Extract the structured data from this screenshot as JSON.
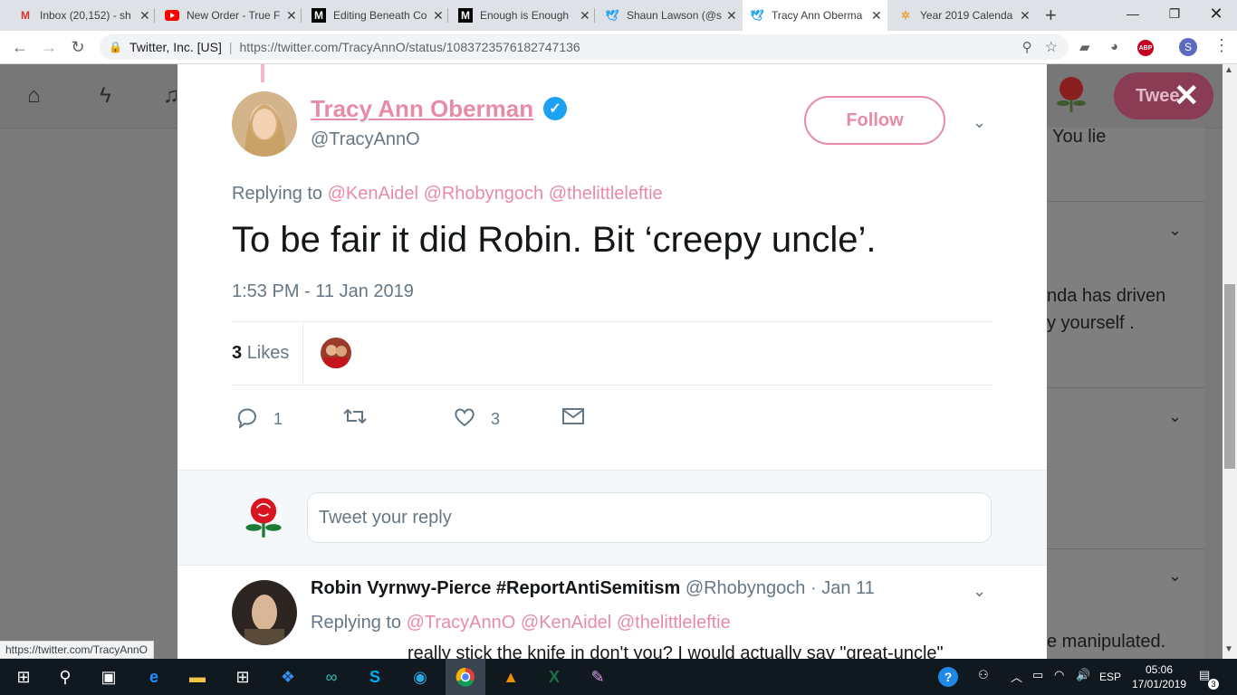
{
  "browser": {
    "tabs": [
      {
        "title": "Inbox (20,152) - sh",
        "icon": "gmail-icon"
      },
      {
        "title": "New Order - True F",
        "icon": "youtube-icon"
      },
      {
        "title": "Editing Beneath Co",
        "icon": "medium-icon"
      },
      {
        "title": "Enough is Enough",
        "icon": "medium-icon"
      },
      {
        "title": "Shaun Lawson (@s",
        "icon": "twitter-icon"
      },
      {
        "title": "Tracy Ann Oberma",
        "icon": "twitter-icon",
        "active": true
      },
      {
        "title": "Year 2019 Calenda",
        "icon": "calendar-icon"
      }
    ],
    "org": "Twitter, Inc. [US]",
    "url": "https://twitter.com/TracyAnnO/status/1083723576182747136",
    "status_url": "https://twitter.com/TracyAnnO"
  },
  "background": {
    "tweet_button": "Twee",
    "snippets": [
      "You lie",
      "nda has driven",
      "y yourself .",
      "e manipulated."
    ]
  },
  "tweet": {
    "name": "Tracy Ann Oberman",
    "handle": "@TracyAnnO",
    "follow_label": "Follow",
    "replying_prefix": "Replying to",
    "mentions": [
      "@KenAidel",
      "@Rhobyngoch",
      "@thelittleleftie"
    ],
    "text": "To be fair it did Robin. Bit ‘creepy uncle’.",
    "timestamp": "1:53 PM - 11 Jan 2019",
    "likes_count": "3",
    "likes_label": "Likes",
    "reply_count": "1",
    "like_count": "3",
    "reply_placeholder": "Tweet your reply"
  },
  "reply2": {
    "name": "Robin Vyrnwy-Pierce #ReportAntiSemitism",
    "handle": "@Rhobyngoch",
    "date": "· Jan 11",
    "replying_prefix": "Replying to",
    "mentions": [
      "@TracyAnnO",
      "@KenAidel",
      "@thelittleleftie"
    ],
    "text": "really stick the knife in don't you? I would actually say \"great-uncle\""
  },
  "taskbar": {
    "lang": "ESP",
    "time": "05:06",
    "date": "17/01/2019",
    "notifications": "3"
  },
  "colors": {
    "accent": "#e88ba6",
    "twitter_blue": "#1da1f2"
  }
}
